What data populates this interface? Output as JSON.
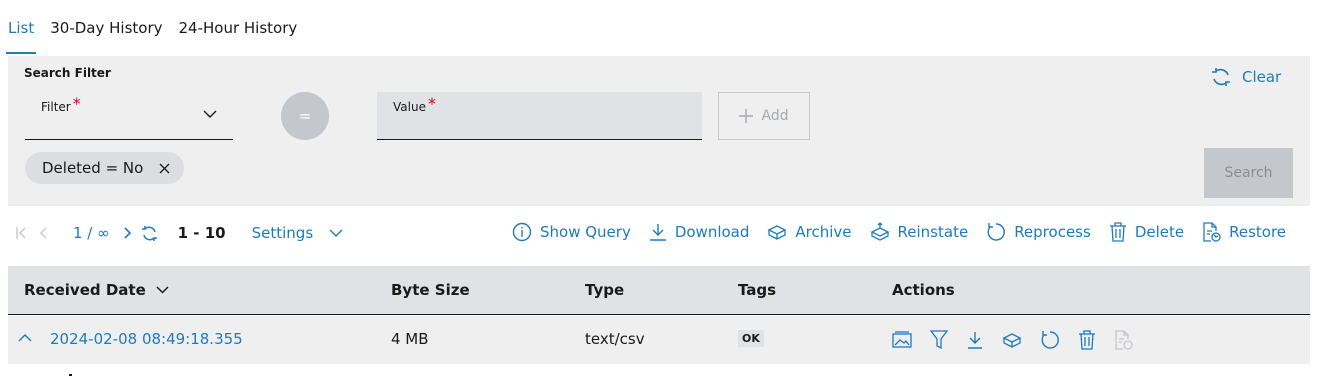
{
  "tabs": [
    {
      "label": "List",
      "active": true
    },
    {
      "label": "30-Day History",
      "active": false
    },
    {
      "label": "24-Hour History",
      "active": false
    }
  ],
  "filter": {
    "title": "Search Filter",
    "filter_label": "Filter",
    "required_mark": "*",
    "operator": "=",
    "value_label": "Value",
    "value": "",
    "add_label": "Add",
    "clear_label": "Clear",
    "search_label": "Search",
    "chips": [
      {
        "label": "Deleted = No"
      }
    ]
  },
  "pager": {
    "page": "1 / ∞",
    "range": "1 - 10",
    "settings_label": "Settings"
  },
  "toolbar_actions": [
    {
      "label": "Show Query",
      "icon": "info-icon"
    },
    {
      "label": "Download",
      "icon": "download-icon"
    },
    {
      "label": "Archive",
      "icon": "archive-icon"
    },
    {
      "label": "Reinstate",
      "icon": "reinstate-icon"
    },
    {
      "label": "Reprocess",
      "icon": "reprocess-icon"
    },
    {
      "label": "Delete",
      "icon": "trash-icon"
    },
    {
      "label": "Restore",
      "icon": "restore-icon"
    }
  ],
  "table": {
    "columns": [
      "Received Date",
      "Byte Size",
      "Type",
      "Tags",
      "Actions"
    ],
    "rows": [
      {
        "received_date": "2024-02-08 08:49:18.355",
        "byte_size": "4 MB",
        "type": "text/csv",
        "tag": "OK"
      }
    ],
    "row_action_icons": [
      "image-icon",
      "filter-icon",
      "download-icon",
      "archive-icon",
      "reprocess-icon",
      "trash-icon",
      "restore-icon"
    ]
  },
  "colors": {
    "accent": "#1d7bbd",
    "panel": "#efeff0",
    "required": "#e00015"
  }
}
